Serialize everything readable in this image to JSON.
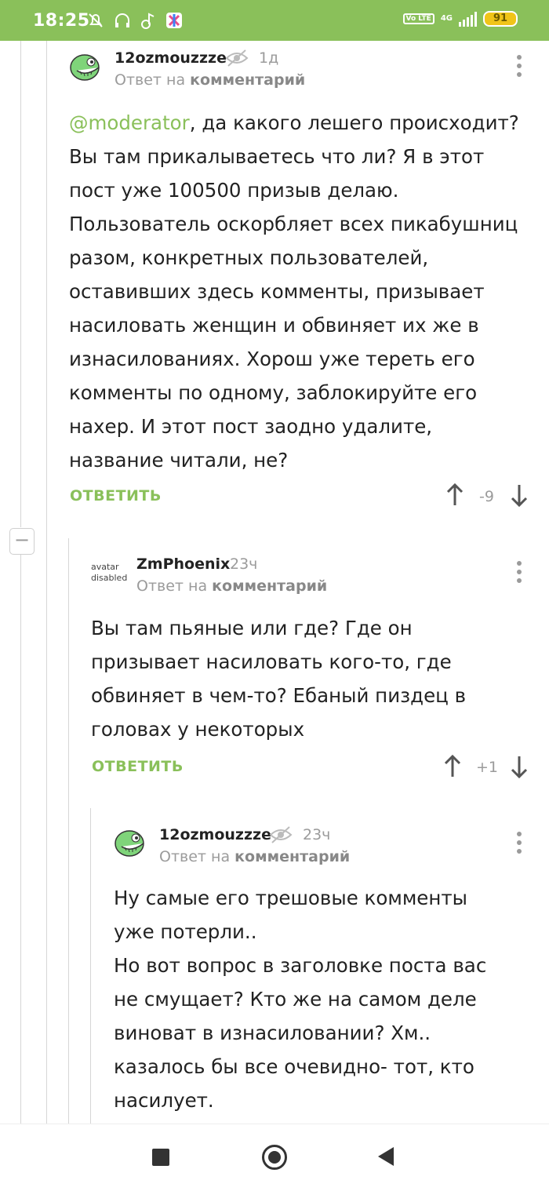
{
  "status_bar": {
    "time": "18:25",
    "network": "4G",
    "volte": "Vo LTE",
    "battery": "91"
  },
  "comments": [
    {
      "author": "12ozmouzzze",
      "time": "1д",
      "reply_prefix": "Ответ на",
      "reply_target": "комментарий",
      "mention": "@moderator",
      "text": ", да какого лешего происходит? Вы там прикалываетесь что ли? Я в этот пост уже 100500 призыв делаю. Пользователь оскорбляет всех пикабушниц разом, конкретных пользователей, оставивших здесь комменты, призывает насиловать женщин и обвиняет их же в изнасилованиях. Хорош уже тереть его комменты по одному, заблокируйте его нахер. И этот пост заодно удалите, название читали, не?",
      "reply_button": "ОТВЕТИТЬ",
      "score": "-9"
    },
    {
      "author": "ZmPhoenix",
      "avatar_text": "avatar disabled",
      "time": "23ч",
      "reply_prefix": "Ответ на",
      "reply_target": "комментарий",
      "text": "Вы там пьяные или где? Где он призывает насиловать кого-то, где обвиняет в чем-то? Ебаный пиздец в головах у некоторых",
      "reply_button": "ОТВЕТИТЬ",
      "score": "+1"
    },
    {
      "author": "12ozmouzzze",
      "time": "23ч",
      "reply_prefix": "Ответ на",
      "reply_target": "комментарий",
      "text": "Ну самые его трешовые комменты уже потерли..\nНо вот вопрос в заголовке поста вас не смущает?  Кто же на самом деле виноват в изнасиловании? Хм.. казалось бы все очевидно- тот, кто насилует."
    }
  ],
  "collapse_symbol": "−",
  "colors": {
    "accent": "#8ac05a",
    "muted": "#9b9b9b",
    "text": "#222222"
  }
}
